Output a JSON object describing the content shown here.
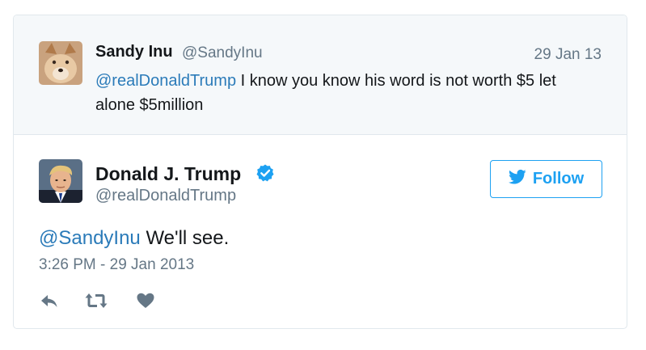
{
  "parent_tweet": {
    "name": "Sandy Inu",
    "handle": "@SandyInu",
    "date": "29 Jan 13",
    "mention": "@realDonaldTrump",
    "text": " I know you know his word is not worth $5 let alone $5million"
  },
  "tweet": {
    "name": "Donald J. Trump",
    "handle": "@realDonaldTrump",
    "verified_icon": "verified-badge-icon",
    "follow_label": "Follow",
    "mention": "@SandyInu",
    "text": " We'll see.",
    "timestamp": "3:26 PM - 29 Jan 2013"
  },
  "actions": [
    {
      "icon": "reply-icon"
    },
    {
      "icon": "retweet-icon"
    },
    {
      "icon": "like-icon"
    }
  ],
  "colors": {
    "accent": "#1da1f2",
    "link": "#2b7bb9",
    "muted": "#657786",
    "parent_bg": "#f5f8fa"
  }
}
